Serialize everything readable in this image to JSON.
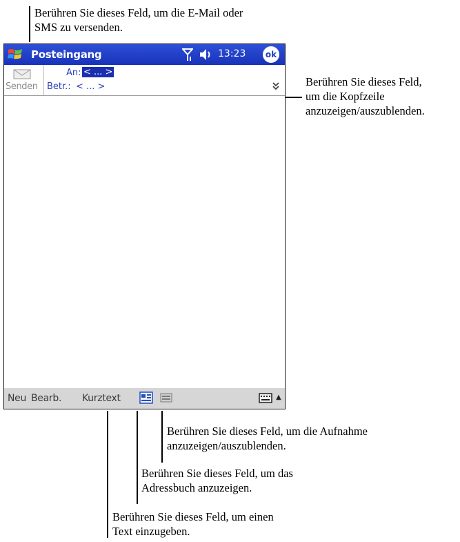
{
  "callouts": {
    "send": [
      "Berühren Sie dieses Feld, um die E-Mail oder",
      "SMS zu versenden."
    ],
    "header": [
      "Berühren Sie dieses Feld,",
      "um die Kopfzeile",
      "anzuzeigen/auszublenden."
    ],
    "recording": [
      "Berühren Sie dieses Feld, um die Aufnahme",
      "anzuzeigen/auszublenden."
    ],
    "addressbook": [
      "Berühren Sie dieses Feld, um das",
      "Adressbuch anzuzeigen."
    ],
    "text": [
      "Berühren Sie dieses Feld, um einen",
      "Text einzugeben."
    ]
  },
  "titlebar": {
    "title": "Posteingang",
    "time": "13:23",
    "ok_label": "ok",
    "icons": [
      "windows-start-icon",
      "signal-icon",
      "speaker-icon"
    ]
  },
  "header": {
    "send_label": "Senden",
    "to_label": "An:",
    "to_value": "< ... >",
    "subject_label": "Betr.:",
    "subject_value": "< ... >",
    "toggle_glyph": "»"
  },
  "menubar": {
    "items": [
      "Neu",
      "Bearb.",
      "Kurztext"
    ],
    "icons": [
      "contacts-icon",
      "recorder-icon",
      "keyboard-icon"
    ],
    "sip_glyph": "▲"
  },
  "colors": {
    "titlebar": "#1f3fc8",
    "field_text": "#2a3fb8",
    "menubar": "#d6d6d6"
  }
}
